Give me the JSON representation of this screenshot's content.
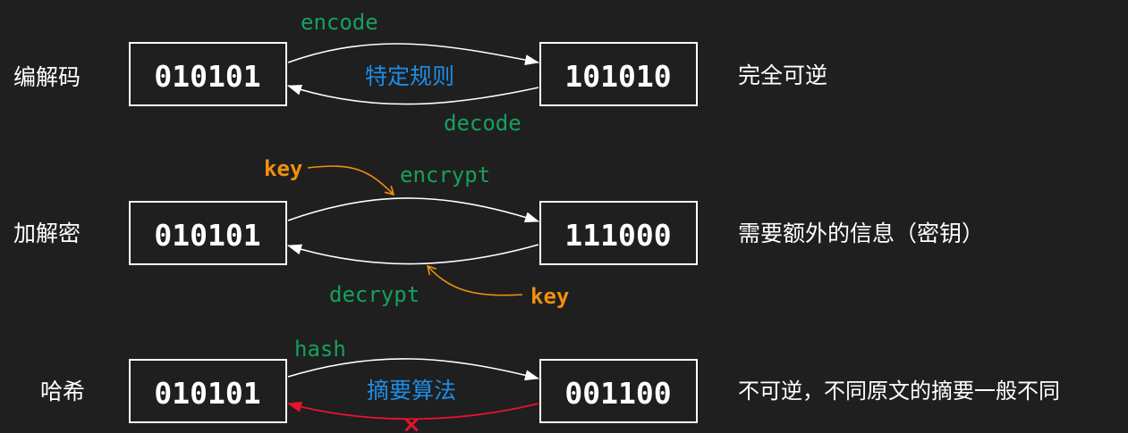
{
  "colors": {
    "background": "#1f1f1f",
    "foreground": "#ffffff",
    "green": "#16a05d",
    "orange": "#f0900e",
    "blue": "#1d8de8",
    "red": "#e8132e"
  },
  "rows": [
    {
      "id": "encoding",
      "label": "编解码",
      "input": "010101",
      "output": "101010",
      "forward_label": "encode",
      "backward_label": "decode",
      "center_label": "特定规则",
      "note": "完全可逆"
    },
    {
      "id": "encryption",
      "label": "加解密",
      "input": "010101",
      "output": "111000",
      "forward_label": "encrypt",
      "backward_label": "decrypt",
      "forward_key": "key",
      "backward_key": "key",
      "note": "需要额外的信息（密钥）"
    },
    {
      "id": "hashing",
      "label": "哈希",
      "input": "010101",
      "output": "001100",
      "forward_label": "hash",
      "center_label": "摘要算法",
      "note": "不可逆，不同原文的摘要一般不同",
      "backward_blocked": true,
      "blocked_mark": "×"
    }
  ]
}
